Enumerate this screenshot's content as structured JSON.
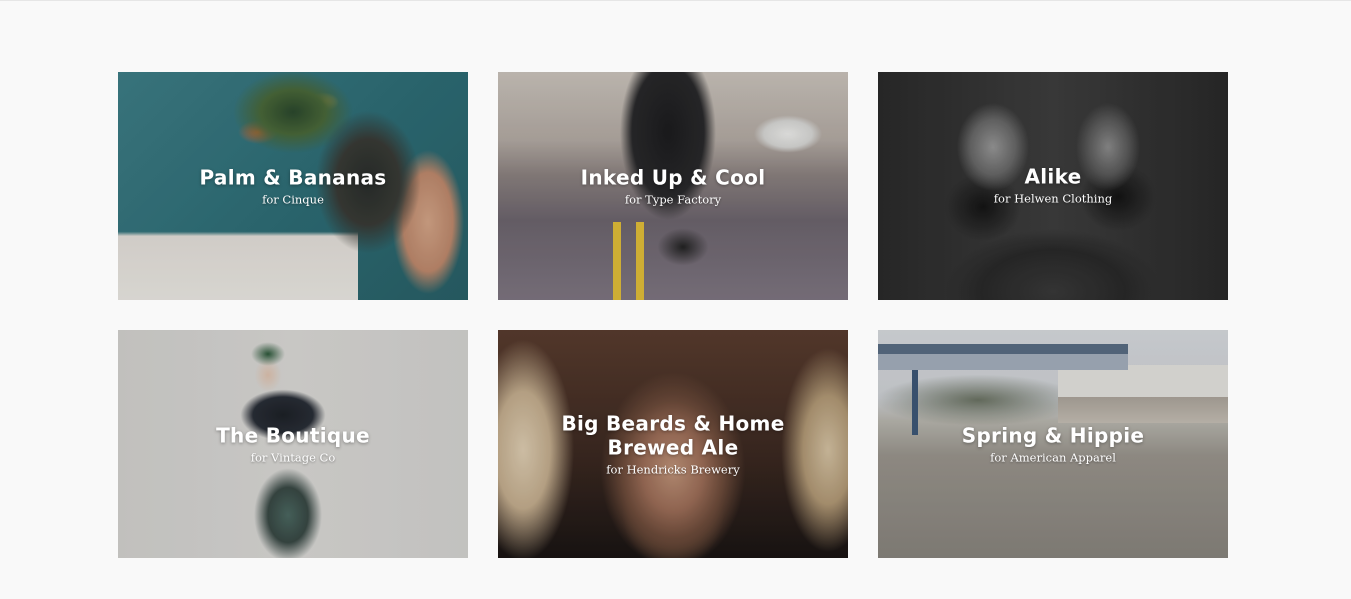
{
  "portfolio": {
    "items": [
      {
        "title": "Palm & Bananas",
        "client": "for Cinque"
      },
      {
        "title": "Inked Up & Cool",
        "client": "for Type Factory"
      },
      {
        "title": "Alike",
        "client": "for Helwen Clothing"
      },
      {
        "title": "The Boutique",
        "client": "for Vintage Co"
      },
      {
        "title": "Big Beards & Home Brewed Ale",
        "client": "for Hendricks Brewery"
      },
      {
        "title": "Spring & Hippie",
        "client": "for American Apparel"
      }
    ]
  }
}
